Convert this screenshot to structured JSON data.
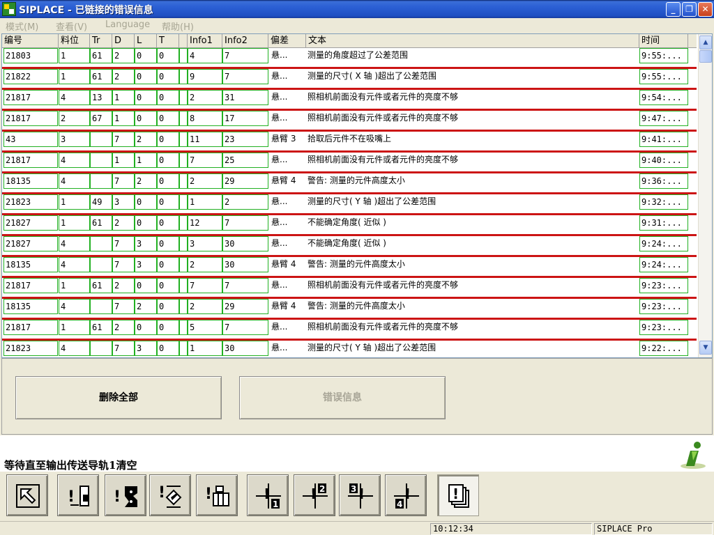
{
  "window": {
    "title": "SIPLACE - 已链接的错误信息",
    "minimize": "_",
    "maximize": "❐",
    "close": "✕"
  },
  "menu": {
    "items": [
      "模式(M)",
      "查看(V)",
      "Language",
      "帮助(H)"
    ]
  },
  "table": {
    "headers": [
      "编号",
      "料位",
      "Tr",
      "D",
      "L",
      "T",
      "",
      "Info1",
      "Info2",
      "偏差",
      "文本",
      "时间"
    ],
    "rows": [
      {
        "id": "21803",
        "slot": "1",
        "tr": "61",
        "d": "2",
        "l": "0",
        "t": "0",
        "info1": "4",
        "info2": "7",
        "dev": "悬...",
        "text": "测量的角度超过了公差范围",
        "time": "9:55:..."
      },
      {
        "id": "21822",
        "slot": "1",
        "tr": "61",
        "d": "2",
        "l": "0",
        "t": "0",
        "info1": "9",
        "info2": "7",
        "dev": "悬...",
        "text": "测量的尺寸( X 轴 )超出了公差范围",
        "time": "9:55:..."
      },
      {
        "id": "21817",
        "slot": "4",
        "tr": "13",
        "d": "1",
        "l": "0",
        "t": "0",
        "info1": "2",
        "info2": "31",
        "dev": "悬...",
        "text": "照相机前面没有元件或者元件的亮度不够",
        "time": "9:54:..."
      },
      {
        "id": "21817",
        "slot": "2",
        "tr": "67",
        "d": "1",
        "l": "0",
        "t": "0",
        "info1": "8",
        "info2": "17",
        "dev": "悬...",
        "text": "照相机前面没有元件或者元件的亮度不够",
        "time": "9:47:..."
      },
      {
        "id": "43",
        "slot": "3",
        "tr": "",
        "d": "7",
        "l": "2",
        "t": "0",
        "info1": "11",
        "info2": "23",
        "dev": "悬臂 3",
        "text": "拾取后元件不在吸嘴上",
        "time": "9:41:..."
      },
      {
        "id": "21817",
        "slot": "4",
        "tr": "",
        "d": "1",
        "l": "1",
        "t": "0",
        "info1": "7",
        "info2": "25",
        "dev": "悬...",
        "text": "照相机前面没有元件或者元件的亮度不够",
        "time": "9:40:..."
      },
      {
        "id": "18135",
        "slot": "4",
        "tr": "",
        "d": "7",
        "l": "2",
        "t": "0",
        "info1": "2",
        "info2": "29",
        "dev": "悬臂 4",
        "text": "警告: 测量的元件高度太小",
        "time": "9:36:..."
      },
      {
        "id": "21823",
        "slot": "1",
        "tr": "49",
        "d": "3",
        "l": "0",
        "t": "0",
        "info1": "1",
        "info2": "2",
        "dev": "悬...",
        "text": "测量的尺寸( Y 轴 )超出了公差范围",
        "time": "9:32:..."
      },
      {
        "id": "21827",
        "slot": "1",
        "tr": "61",
        "d": "2",
        "l": "0",
        "t": "0",
        "info1": "12",
        "info2": "7",
        "dev": "悬...",
        "text": "不能确定角度( 近似 )",
        "time": "9:31:..."
      },
      {
        "id": "21827",
        "slot": "4",
        "tr": "",
        "d": "7",
        "l": "3",
        "t": "0",
        "info1": "3",
        "info2": "30",
        "dev": "悬...",
        "text": "不能确定角度( 近似 )",
        "time": "9:24:..."
      },
      {
        "id": "18135",
        "slot": "4",
        "tr": "",
        "d": "7",
        "l": "3",
        "t": "0",
        "info1": "2",
        "info2": "30",
        "dev": "悬臂 4",
        "text": "警告: 测量的元件高度太小",
        "time": "9:24:..."
      },
      {
        "id": "21817",
        "slot": "1",
        "tr": "61",
        "d": "2",
        "l": "0",
        "t": "0",
        "info1": "7",
        "info2": "7",
        "dev": "悬...",
        "text": "照相机前面没有元件或者元件的亮度不够",
        "time": "9:23:..."
      },
      {
        "id": "18135",
        "slot": "4",
        "tr": "",
        "d": "7",
        "l": "2",
        "t": "0",
        "info1": "2",
        "info2": "29",
        "dev": "悬臂 4",
        "text": "警告: 测量的元件高度太小",
        "time": "9:23:..."
      },
      {
        "id": "21817",
        "slot": "1",
        "tr": "61",
        "d": "2",
        "l": "0",
        "t": "0",
        "info1": "5",
        "info2": "7",
        "dev": "悬...",
        "text": "照相机前面没有元件或者元件的亮度不够",
        "time": "9:23:..."
      },
      {
        "id": "21823",
        "slot": "4",
        "tr": "",
        "d": "7",
        "l": "3",
        "t": "0",
        "info1": "1",
        "info2": "30",
        "dev": "悬...",
        "text": "测量的尺寸( Y 轴 )超出了公差范围",
        "time": "9:22:..."
      }
    ]
  },
  "scrollbar": {
    "up": "▲",
    "down": "▼"
  },
  "actions": {
    "delete_all": "删除全部",
    "error_info": "错误信息"
  },
  "status_message": "等待直至输出传送导轨1清空",
  "toolbar": {
    "buttons": [
      {
        "icon": "pointer-arrow-icon"
      },
      {
        "icon": "feeder-warning-icon"
      },
      {
        "icon": "component-warning-icon"
      },
      {
        "icon": "nozzle-warning-icon"
      },
      {
        "icon": "tray-warning-icon"
      },
      {
        "icon": "gantry-1-icon",
        "label": "1"
      },
      {
        "icon": "gantry-2-icon",
        "label": "2"
      },
      {
        "icon": "gantry-3-icon",
        "label": "3"
      },
      {
        "icon": "gantry-4-icon",
        "label": "4"
      },
      {
        "icon": "error-list-icon"
      }
    ]
  },
  "statusbar": {
    "time": "10:12:34",
    "product": "SIPLACE Pro"
  },
  "colors": {
    "row_separator": "#cc1414",
    "cell_border": "#21b021",
    "titlebar": "#2b5fd4"
  }
}
